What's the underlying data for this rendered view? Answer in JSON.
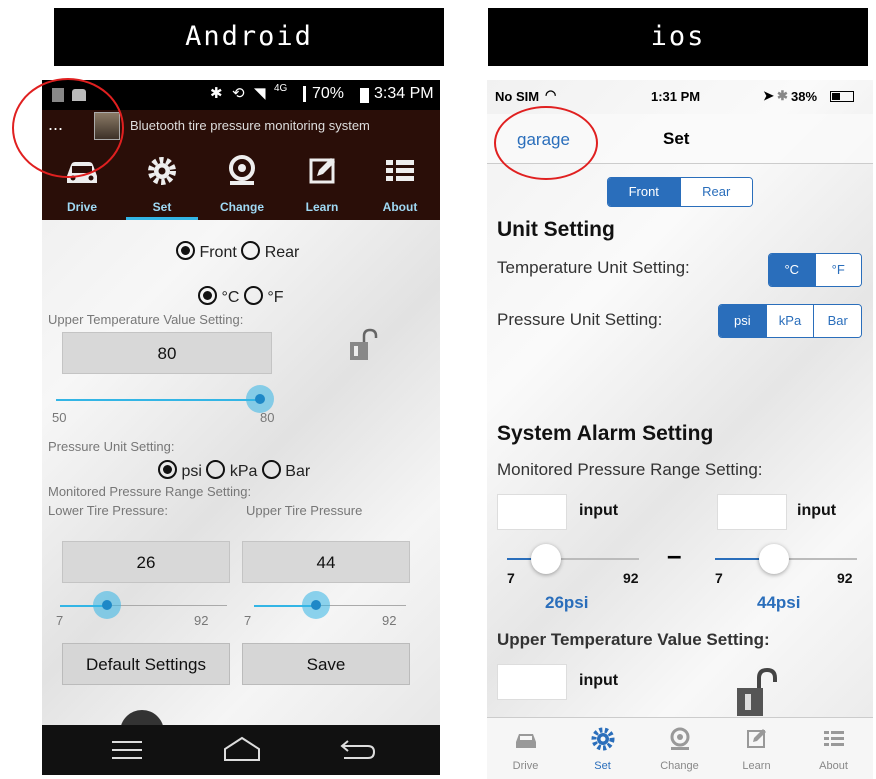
{
  "labels": {
    "android": "Android",
    "ios": "ios"
  },
  "android": {
    "status": {
      "battery": "70%",
      "time": "3:34 PM",
      "net": "4G"
    },
    "notification": {
      "menu": "...",
      "title": "Bluetooth tire pressure monitoring system"
    },
    "tabs": [
      {
        "label": "Drive",
        "icon": "car-icon"
      },
      {
        "label": "Set",
        "icon": "gear-icon"
      },
      {
        "label": "Change",
        "icon": "tire-icon"
      },
      {
        "label": "Learn",
        "icon": "edit-icon"
      },
      {
        "label": "About",
        "icon": "list-icon"
      }
    ],
    "active_tab": "Set",
    "position": {
      "front": "Front",
      "rear": "Rear",
      "selected": "Front"
    },
    "temp_unit": {
      "c": "°C",
      "f": "°F",
      "selected": "°C"
    },
    "upper_temp": {
      "label": "Upper Temperature Value Setting:",
      "value": "80",
      "min": "50",
      "max": "80",
      "level": 1.0
    },
    "pressure_unit": {
      "label": "Pressure Unit Setting:",
      "psi": "psi",
      "kpa": "kPa",
      "bar": "Bar",
      "selected": "psi"
    },
    "pressure_range": {
      "label": "Monitored Pressure Range Setting:",
      "lower_label": "Lower Tire Pressure:",
      "upper_label": "Upper Tire Pressure",
      "lower_value": "26",
      "upper_value": "44",
      "min": "7",
      "max": "92"
    },
    "buttons": {
      "default": "Default Settings",
      "save": "Save"
    }
  },
  "ios": {
    "status": {
      "carrier": "No SIM",
      "time": "1:31 PM",
      "battery": "38%"
    },
    "nav": {
      "back": "garage",
      "title": "Set"
    },
    "position": {
      "front": "Front",
      "rear": "Rear",
      "selected": "Front"
    },
    "unit_setting": {
      "heading": "Unit Setting",
      "temp_label": "Temperature Unit Setting:",
      "temp_c": "°C",
      "temp_f": "°F",
      "temp_selected": "°C",
      "pressure_label": "Pressure Unit Setting:",
      "p_psi": "psi",
      "p_kpa": "kPa",
      "p_bar": "Bar",
      "pressure_selected": "psi"
    },
    "alarm": {
      "heading": "System Alarm Setting",
      "range_label": "Monitored Pressure Range Setting:",
      "input_label": "input",
      "dash": "–",
      "min": "7",
      "max": "92",
      "lower_display": "26psi",
      "upper_display": "44psi",
      "temp_label": "Upper Temperature Value Setting:"
    },
    "tabs": [
      {
        "label": "Drive",
        "icon": "car-icon"
      },
      {
        "label": "Set",
        "icon": "gear-icon"
      },
      {
        "label": "Change",
        "icon": "tire-icon"
      },
      {
        "label": "Learn",
        "icon": "edit-icon"
      },
      {
        "label": "About",
        "icon": "list-icon"
      }
    ],
    "active_tab": "Set"
  },
  "colors": {
    "accent_android": "#33b5e5",
    "accent_ios": "#2a6ebb",
    "annotation": "#e02020"
  }
}
